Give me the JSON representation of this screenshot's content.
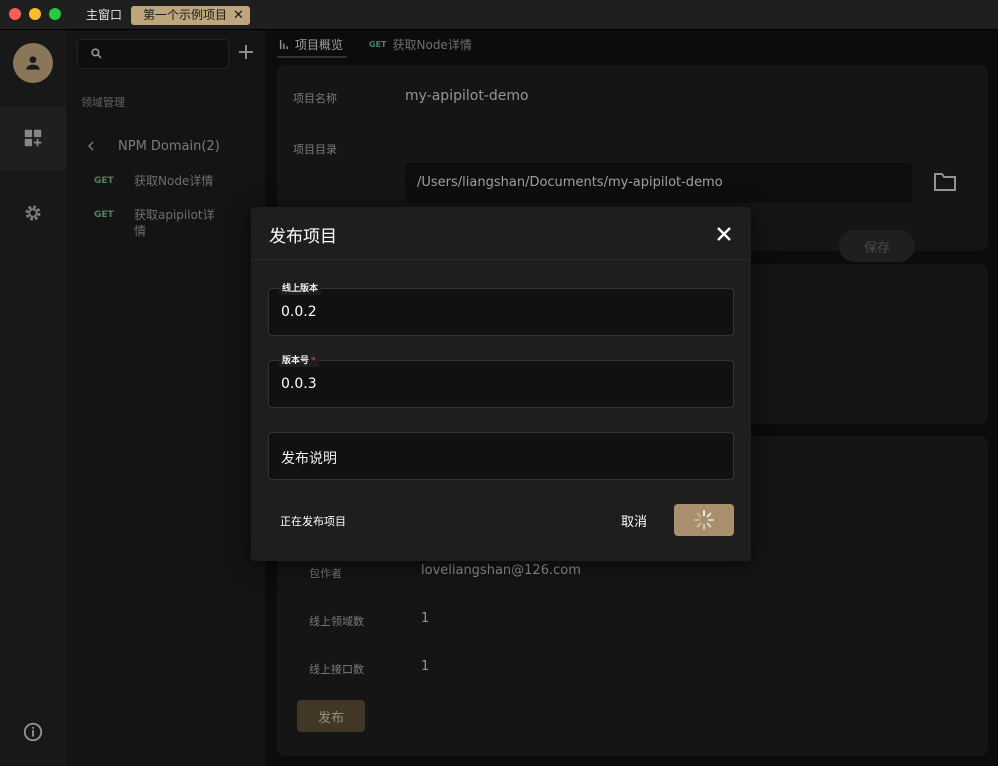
{
  "window": {
    "tabs": [
      {
        "label": "主窗口"
      },
      {
        "label": "第一个示例项目",
        "close": "✕"
      }
    ],
    "colors": {
      "close": "#ff5f57",
      "minimize": "#febc2e",
      "maximize": "#28c840",
      "accent": "#bfa57c"
    }
  },
  "sidebar": {
    "search_placeholder": "",
    "add_label": "+",
    "section_title": "领域管理",
    "domain": {
      "name": "NPM Domain(2)"
    },
    "apis": [
      {
        "method": "GET",
        "name": "获取Node详情"
      },
      {
        "method": "GET",
        "name": "获取apipilot详情"
      }
    ]
  },
  "main": {
    "tabs": [
      {
        "label": "项目概览",
        "icon": "bar-chart-icon"
      },
      {
        "method": "GET",
        "label": "获取Node详情"
      }
    ],
    "project": {
      "name_label": "项目名称",
      "name_value": "my-apipilot-demo",
      "dir_label": "项目目录",
      "dir_value": "/Users/liangshan/Documents/my-apipilot-demo",
      "save_label": "保存"
    },
    "publish_info": {
      "author_label": "包作者",
      "author_value": "loveliangshan@126.com",
      "domains_label": "线上领域数",
      "domains_value": "1",
      "apis_label": "线上接口数",
      "apis_value": "1",
      "publish_label": "发布"
    }
  },
  "dialog": {
    "title": "发布项目",
    "online_version_label": "线上版本",
    "online_version_value": "0.0.2",
    "version_label": "版本号",
    "required_mark": "*",
    "version_value": "0.0.3",
    "notes_placeholder": "发布说明",
    "status_text": "正在发布项目",
    "cancel_label": "取消"
  }
}
